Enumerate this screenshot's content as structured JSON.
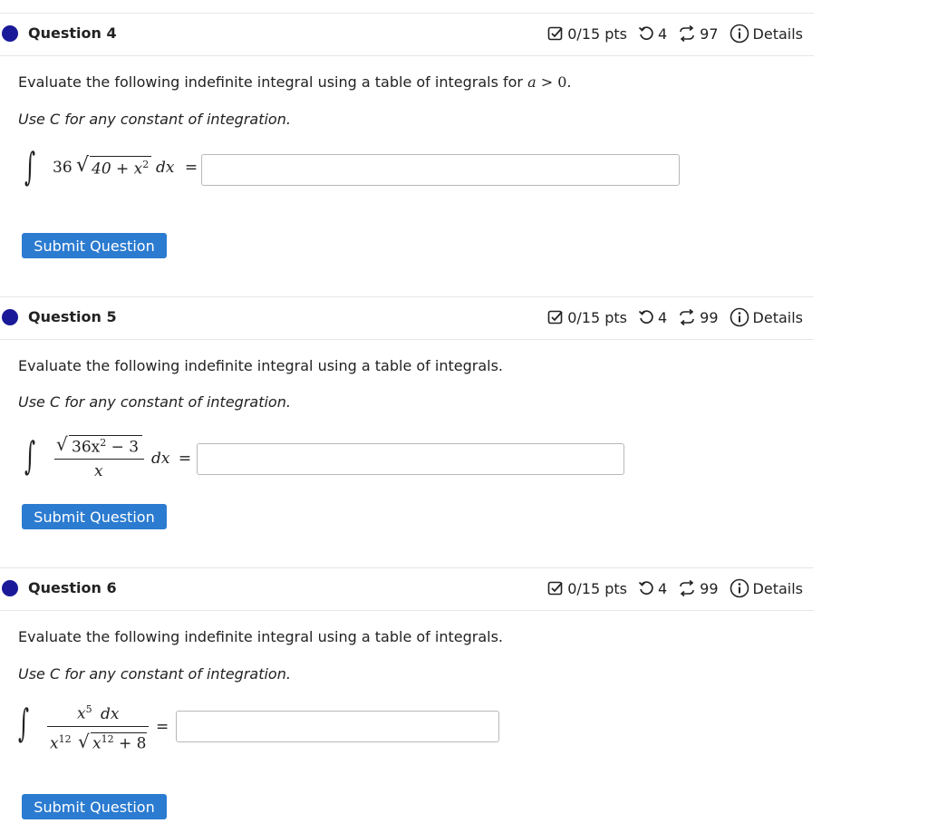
{
  "questions": [
    {
      "title": "Question 4",
      "score": "0/15 pts",
      "retries": "4",
      "attempts": "97",
      "details": "Details",
      "prompt_text": "Evaluate the following indefinite integral using a table of integrals for",
      "prompt_math_var": "a",
      "prompt_math_rest": " > 0.",
      "instruction": "Use C for any constant of integration.",
      "expr_coef": "36",
      "expr_radicand": "40 + x",
      "expr_exp": "2",
      "expr_diff": "dx",
      "equals": "=",
      "answer_value": "",
      "submit_label": "Submit Question"
    },
    {
      "title": "Question 5",
      "score": "0/15 pts",
      "retries": "4",
      "attempts": "99",
      "details": "Details",
      "prompt_text": "Evaluate the following indefinite integral using a table of integrals.",
      "instruction": "Use C for any constant of integration.",
      "num_radicand": "36x",
      "num_exp": "2",
      "num_rest": " − 3",
      "den": "x",
      "expr_diff": "dx",
      "equals": "=",
      "answer_value": "",
      "submit_label": "Submit Question"
    },
    {
      "title": "Question 6",
      "score": "0/15 pts",
      "retries": "4",
      "attempts": "99",
      "details": "Details",
      "prompt_text": "Evaluate the following indefinite integral using a table of integrals.",
      "instruction": "Use C for any constant of integration.",
      "num_base": "x",
      "num_exp": "5",
      "num_diff": "dx",
      "den_base": "x",
      "den_exp": "12",
      "den_radicand": "x",
      "den_radicand_exp": "12",
      "den_rest": " + 8",
      "equals": "=",
      "answer_value": "",
      "submit_label": "Submit Question"
    }
  ],
  "colors": {
    "dot": "#1a1a99",
    "submit_bg": "#2b7bd0",
    "border": "#e6e6e6"
  },
  "icons": [
    "checkbox-icon",
    "retry-icon",
    "attempts-icon",
    "info-icon"
  ]
}
